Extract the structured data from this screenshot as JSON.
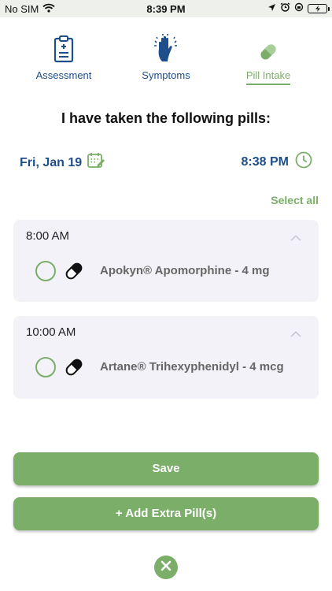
{
  "status_bar": {
    "carrier": "No SIM",
    "time": "8:39 PM",
    "icons": [
      "wifi-icon",
      "location-icon",
      "alarm-icon",
      "orientation-lock-icon",
      "battery-charging-icon"
    ]
  },
  "tabs": [
    {
      "label": "Assessment",
      "icon": "clipboard-icon",
      "active": false
    },
    {
      "label": "Symptoms",
      "icon": "hand-tremor-icon",
      "active": false
    },
    {
      "label": "Pill Intake",
      "icon": "pill-icon",
      "active": true
    }
  ],
  "heading": "I have taken the following pills:",
  "date": {
    "label": "Fri, Jan 19",
    "icon": "calendar-edit-icon"
  },
  "time": {
    "label": "8:38 PM",
    "icon": "clock-icon"
  },
  "select_all": "Select all",
  "schedule": [
    {
      "time": "8:00 AM",
      "pills": [
        {
          "name": "Apokyn® Apomorphine - 4 mg",
          "checked": false
        }
      ]
    },
    {
      "time": "10:00 AM",
      "pills": [
        {
          "name": "Artane® Trihexyphenidyl - 4 mcg",
          "checked": false
        }
      ]
    }
  ],
  "buttons": {
    "save": "Save",
    "add_extra": "+ Add Extra Pill(s)"
  },
  "colors": {
    "accent_green": "#7bae68",
    "brand_blue": "#1e4f8a",
    "card_bg": "#f3f2f9",
    "status_bar_bg": "#eef0ec"
  }
}
